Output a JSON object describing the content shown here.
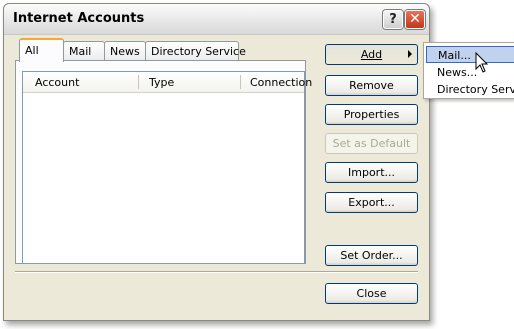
{
  "window": {
    "title": "Internet Accounts",
    "help_glyph": "?",
    "close_glyph": "✕"
  },
  "tabs": [
    {
      "label": "All",
      "active": true
    },
    {
      "label": "Mail"
    },
    {
      "label": "News"
    },
    {
      "label": "Directory Service"
    }
  ],
  "list": {
    "columns": [
      "Account",
      "Type",
      "Connection"
    ],
    "rows": []
  },
  "buttons": {
    "add": "Add",
    "remove": "Remove",
    "properties": "Properties",
    "set_default": "Set as Default",
    "import": "Import...",
    "export": "Export...",
    "set_order": "Set Order...",
    "close": "Close"
  },
  "add_menu": {
    "items": [
      "Mail...",
      "News...",
      "Directory Service"
    ],
    "highlighted": "Mail..."
  },
  "colors": {
    "dialog_bg": "#ece9d8",
    "close_button": "#c2361c",
    "active_tab_accent": "#f4a83a",
    "menu_highlight": "#c1d2ee"
  }
}
